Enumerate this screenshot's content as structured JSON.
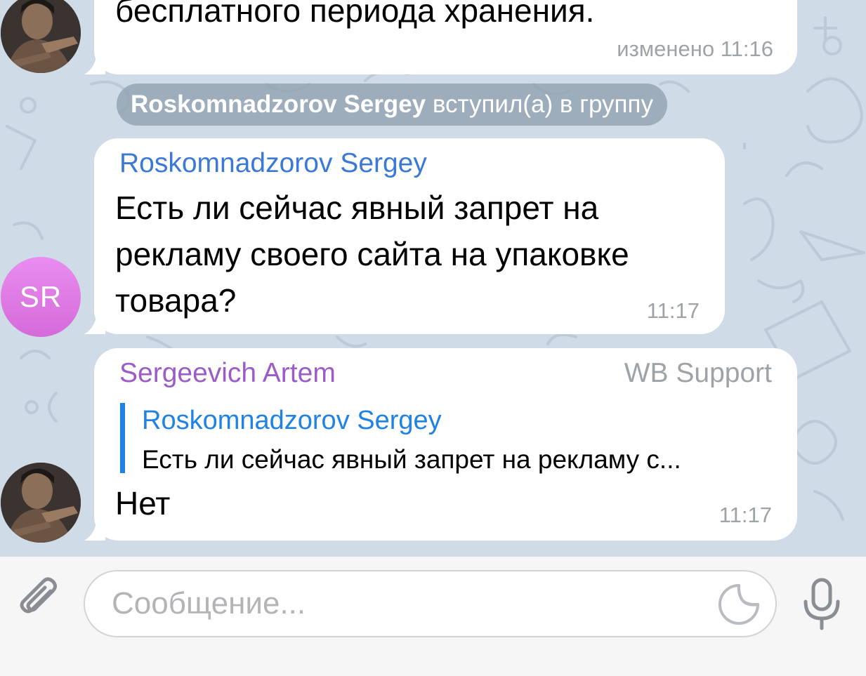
{
  "messages": {
    "first": {
      "text_tail": "бесплатного периода хранения.",
      "time": "изменено 11:16"
    },
    "service": {
      "name": "Roskomnadzorov Sergey",
      "action": " вступил(а) в группу"
    },
    "second": {
      "sender": "Roskomnadzorov Sergey",
      "line1": "Есть ли сейчас явный запрет на",
      "line2": "рекламу своего сайта на упаковке",
      "line3": "товара?",
      "time": "11:17",
      "avatar_initials": "SR"
    },
    "third": {
      "sender": "Sergeevich Artem",
      "role": "WB Support",
      "reply_name": "Roskomnadzorov Sergey",
      "reply_text": "Есть ли сейчас явный запрет на рекламу с...",
      "text": "Нет",
      "time": "11:17"
    }
  },
  "input": {
    "placeholder": "Сообщение..."
  },
  "icons": {
    "attach": "paperclip-icon",
    "sticker": "sticker-icon",
    "mic": "microphone-icon"
  },
  "colors": {
    "chat_background": "#cfdbe6",
    "link_blue": "#3b79d8",
    "artem_purple": "#9b5cc9",
    "reply_blue": "#1e82e6",
    "avatar_pink": "#e07ae4"
  }
}
